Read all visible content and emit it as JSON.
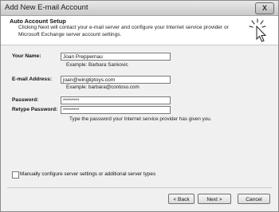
{
  "window": {
    "title": "Add New E-mail Account",
    "close_label": "X"
  },
  "header": {
    "title": "Auto Account Setup",
    "description": "Clicking Next will contact your e-mail server and configure your Internet service provider or Microsoft Exchange server account settings."
  },
  "form": {
    "name": {
      "label": "Your Name:",
      "value": "Joan Preppernau",
      "hint": "Example: Barbara Sankovic"
    },
    "email": {
      "label": "E-mail Address:",
      "value": "joan@wingtiptoys.com",
      "hint": "Example: barbara@contoso.com"
    },
    "password": {
      "label": "Password:",
      "value": "********"
    },
    "retype_password": {
      "label": "Retype Password:",
      "value": "********",
      "hint": "Type the password your Internet service provider has given you."
    }
  },
  "manual_config": {
    "label": "Manually configure server settings or additional server types",
    "checked": false
  },
  "buttons": {
    "back": "< Back",
    "next": "Next >",
    "cancel": "Cancel"
  }
}
